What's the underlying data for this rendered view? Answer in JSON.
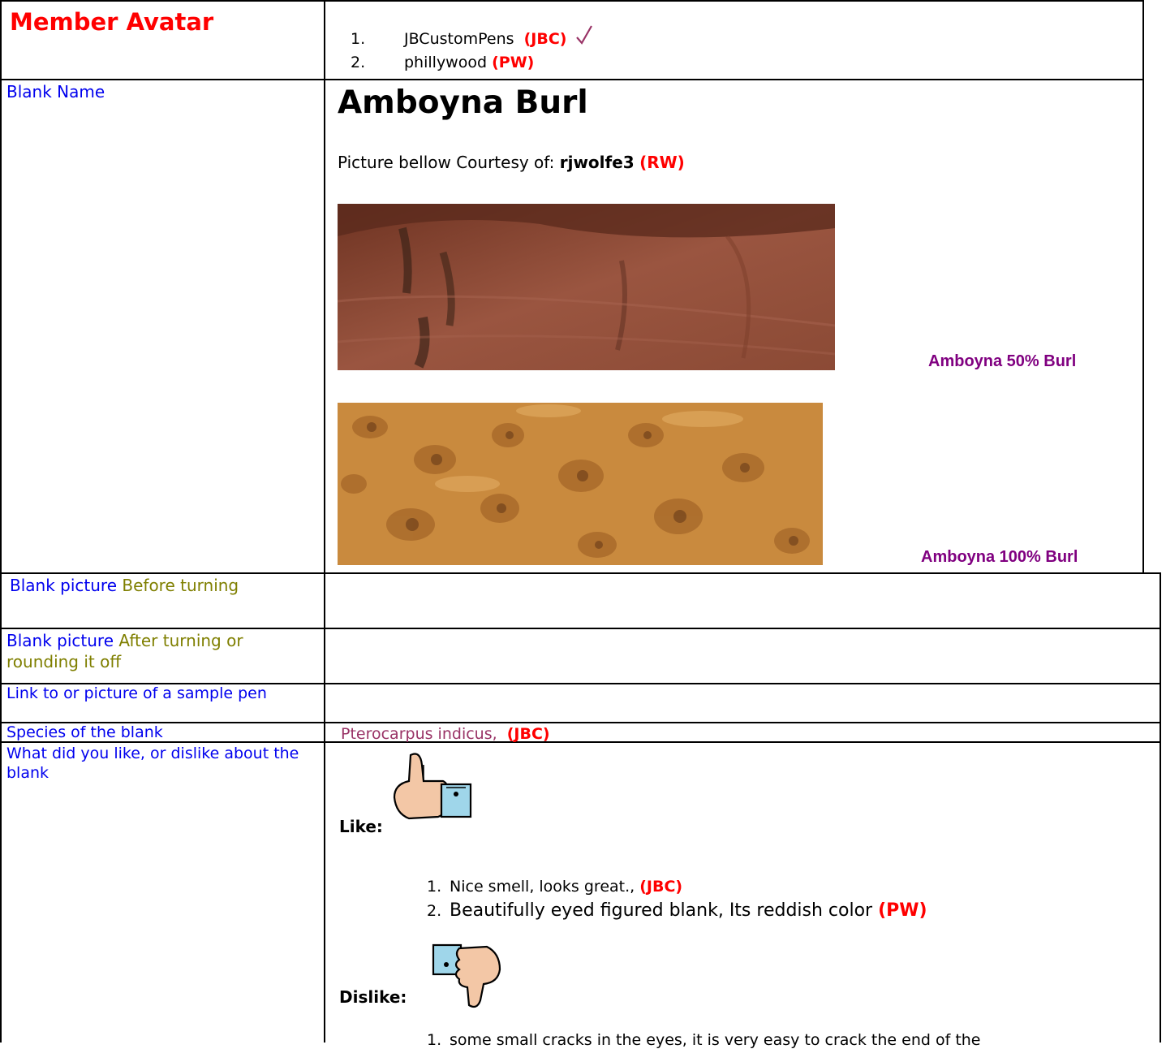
{
  "header": {
    "left_title": "Member Avatar",
    "members": [
      {
        "num": "1.",
        "name": "JBCustomPens",
        "tag": "(JBC)",
        "checked": true
      },
      {
        "num": "2.",
        "name": "phillywood",
        "tag": "(PW)"
      }
    ]
  },
  "blank_name_row": {
    "label": "Blank Name",
    "title": "Amboyna Burl",
    "courtesy_text": "Picture bellow Courtesy of:",
    "courtesy_user": "rjwolfe3",
    "courtesy_tag": "(RW)",
    "images": [
      {
        "caption": "Amboyna 50% Burl",
        "icon": "amboyna-50-burl-image"
      },
      {
        "caption": "Amboyna 100% Burl",
        "icon": "amboyna-100-burl-image"
      }
    ]
  },
  "rows": {
    "before_label_a": "Blank picture",
    "before_label_b": "Before turning",
    "after_label_a": "Blank picture",
    "after_label_b": "After turning or rounding it off",
    "sample_label": "Link to or picture of a sample pen",
    "species_label": "Species of the blank",
    "species_value": "Pterocarpus indicus,",
    "species_tag": "(JBC)",
    "like_label": "What did you like, or dislike about the blank"
  },
  "likes": {
    "like_heading": "Like:",
    "like_items": [
      {
        "num": "1.",
        "text": "Nice smell, looks great.,",
        "tag": "(JBC)"
      },
      {
        "num": "2.",
        "text": "Beautifully eyed figured blank, Its reddish color",
        "tag": "(PW)"
      }
    ],
    "dislike_heading": "Dislike:",
    "dislike_items": [
      {
        "num": "1.",
        "text": "some small cracks in the eyes, it is very easy to crack the end of the"
      }
    ]
  },
  "colors": {
    "label_blue": "#0000ee",
    "olive": "#7f7f00",
    "tag_red": "#ff0000",
    "caption_purple": "#800080"
  }
}
